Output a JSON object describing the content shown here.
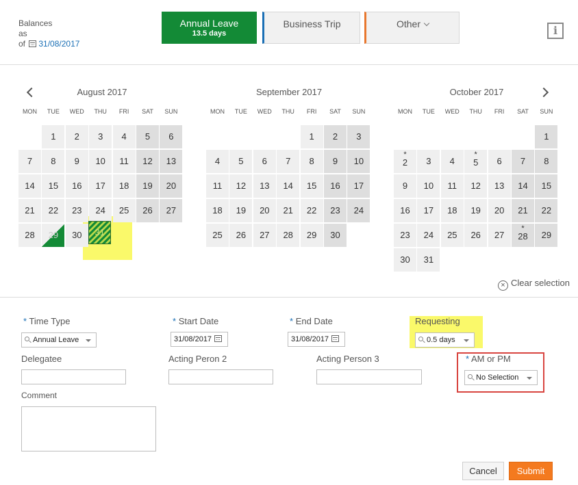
{
  "header": {
    "balances_line1": "Balances",
    "balances_line2": "as",
    "balances_line3": "of",
    "balance_date": "31/08/2017",
    "tabs": [
      {
        "label": "Annual Leave",
        "sub": "13.5 days",
        "color": "#138a36"
      },
      {
        "label": "Business Trip",
        "accent": "#1a6fb5"
      },
      {
        "label": "Other",
        "accent": "#e8772e"
      }
    ],
    "info_icon": "i"
  },
  "weekdays": [
    "MON",
    "TUE",
    "WED",
    "THU",
    "FRI",
    "SAT",
    "SUN"
  ],
  "calendars": [
    {
      "title": "August 2017",
      "first_col": 1,
      "days": 31,
      "starred": [],
      "selected_start": 29,
      "selected_end": 31
    },
    {
      "title": "September 2017",
      "first_col": 4,
      "days": 30,
      "starred": []
    },
    {
      "title": "October 2017",
      "first_col": 6,
      "days": 31,
      "starred": [
        2,
        5,
        28
      ]
    }
  ],
  "clear_selection": {
    "icon": "×",
    "label": "Clear selection"
  },
  "form": {
    "required_mark": "*",
    "time_type": {
      "label": "Time Type",
      "value": "Annual Leave"
    },
    "start_date": {
      "label": "Start Date",
      "value": "31/08/2017"
    },
    "end_date": {
      "label": "End Date",
      "value": "31/08/2017"
    },
    "requesting": {
      "label": "Requesting",
      "value": "0.5 days"
    },
    "delegatee": {
      "label": "Delegatee",
      "value": ""
    },
    "acting2": {
      "label": "Acting Peron 2",
      "value": ""
    },
    "acting3": {
      "label": "Acting Person 3",
      "value": ""
    },
    "ampm": {
      "label": "AM or PM",
      "value": "No Selection"
    },
    "comment": {
      "label": "Comment",
      "value": ""
    }
  },
  "buttons": {
    "cancel": "Cancel",
    "submit": "Submit"
  },
  "colors": {
    "highlight": "#faf96a",
    "selected": "#138a36",
    "submit": "#f47a1f",
    "annotation": "#d8443f"
  }
}
